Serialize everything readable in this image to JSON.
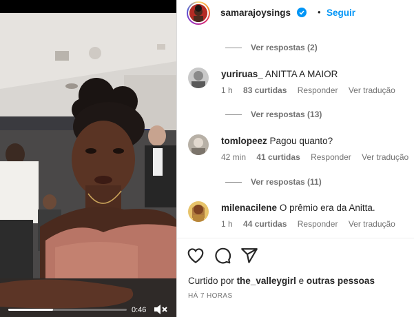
{
  "video": {
    "timestamp": "0:46",
    "progress": 0.38
  },
  "post": {
    "username": "samarajoysings",
    "follow_label": "Seguir",
    "dot": "•"
  },
  "comments": [
    {
      "view_replies": "Ver respostas (2)"
    },
    {
      "username": "yuriruas_",
      "text": "ANITTA A MAIOR",
      "time": "1 h",
      "likes": "83 curtidas",
      "reply_label": "Responder",
      "translate_label": "Ver tradução",
      "view_replies": "Ver respostas (13)"
    },
    {
      "username": "tomlopeez",
      "text": "Pagou quanto?",
      "time": "42 min",
      "likes": "41 curtidas",
      "reply_label": "Responder",
      "translate_label": "Ver tradução",
      "view_replies": "Ver respostas (11)"
    },
    {
      "username": "milenacilene",
      "text": "O prêmio era da Anitta.",
      "time": "1 h",
      "likes": "44 curtidas",
      "reply_label": "Responder",
      "translate_label": "Ver tradução"
    }
  ],
  "footer": {
    "liked_by_prefix": "Curtido por",
    "liked_by_user": "the_valleygirl",
    "liked_by_joiner": "e",
    "liked_by_others": "outras pessoas",
    "posted_ago": "HÁ 7 HORAS"
  },
  "icons": {
    "like": "heart-icon",
    "comment": "comment-icon",
    "share": "share-icon",
    "mute": "muted-speaker-icon",
    "verified": "verified-badge-icon"
  },
  "colors": {
    "link_blue": "#0095f6",
    "secondary_text": "#737373"
  }
}
